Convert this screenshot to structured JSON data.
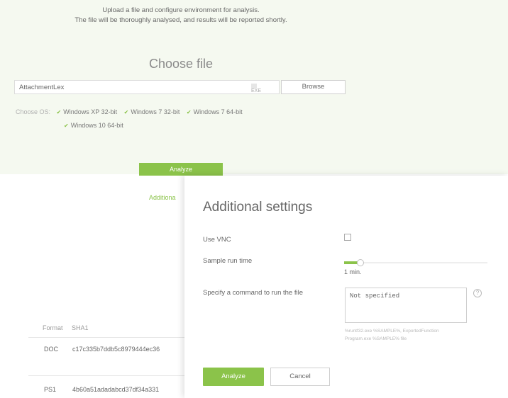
{
  "intro": {
    "line1": "Upload a file and configure environment for analysis.",
    "line2": "The file will be thoroughly analysed, and results will be reported shortly."
  },
  "choose_title": "Choose file",
  "file": {
    "name": "AttachmentLex",
    "ext_hint": "EXE",
    "browse_label": "Browse"
  },
  "os": {
    "label": "Choose OS:",
    "options": [
      {
        "label": "Windows XP 32-bit",
        "checked": true
      },
      {
        "label": "Windows 7 32-bit",
        "checked": true
      },
      {
        "label": "Windows 7 64-bit",
        "checked": true
      },
      {
        "label": "Windows 10 64-bit",
        "checked": true
      }
    ]
  },
  "analyze_label": "Analyze",
  "additional_link": "Additiona",
  "table": {
    "headers": [
      "Format",
      "SHA1"
    ],
    "rows": [
      {
        "format": "DOC",
        "hash": "c17c335b7ddb5c8979444ec36"
      },
      {
        "format": "PS1",
        "hash": "4b60a51adadabcd37df34a331"
      }
    ]
  },
  "modal": {
    "title": "Additional settings",
    "use_vnc_label": "Use VNC",
    "use_vnc_checked": false,
    "sample_run_label": "Sample run time",
    "sample_run_value": "1 min.",
    "sample_run_fraction": 0.1,
    "command_label": "Specify a command to run the file",
    "command_value": "Not specified",
    "help_icon": "question-circle-icon",
    "hint_line1": "%runtf32.exe %SAMPLE%, ExportedFunction",
    "hint_line2": "Program.exe %SAMPLE% file",
    "analyze_label": "Analyze",
    "cancel_label": "Cancel"
  },
  "colors": {
    "accent": "#8bc34a",
    "panel_bg": "#f5f9f0"
  }
}
